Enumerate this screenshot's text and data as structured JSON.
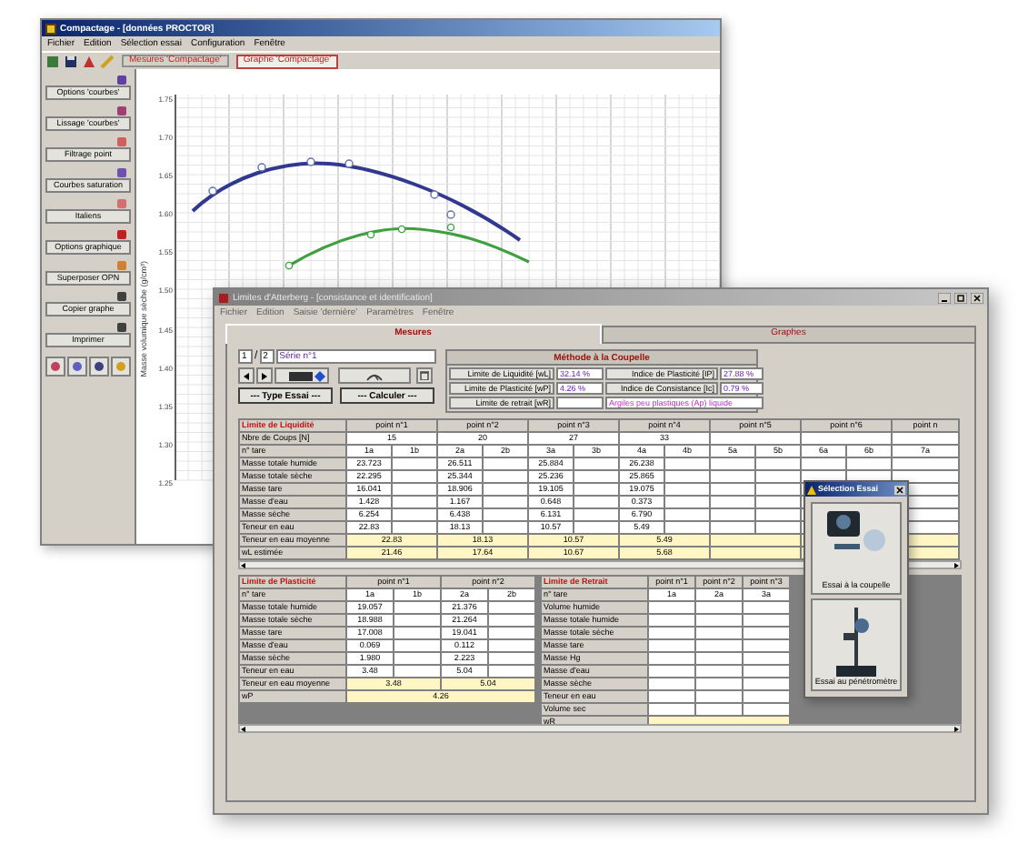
{
  "back_window": {
    "title": "Compactage - [données PROCTOR]",
    "menu": [
      "Fichier",
      "Edition",
      "Sélection essai",
      "Configuration",
      "Fenêtre"
    ],
    "tabs": [
      {
        "label": "Mesures 'Compactage'",
        "selected": false
      },
      {
        "label": "Graphe 'Compactage'",
        "selected": true
      }
    ],
    "tools": [
      "Options 'courbes'",
      "Lissage 'courbes'",
      "Filtrage point",
      "Courbes saturation",
      "Italiens",
      "Options graphique",
      "Superposer OPN",
      "Copier graphe",
      "Imprimer"
    ],
    "chart": {
      "y_axis_title": "Masse volumique sèche (g/cm³)",
      "y_ticks": [
        "1.75",
        "1.70",
        "1.65",
        "1.60",
        "1.55",
        "1.50",
        "1.45",
        "1.40",
        "1.35",
        "1.30",
        "1.25"
      ]
    }
  },
  "front_window": {
    "title": "Limites d'Atterberg - [consistance et identification]",
    "menu": [
      "Fichier",
      "Edition",
      "Saisie 'dernière'",
      "Paramètres",
      "Fenêtre"
    ],
    "tabs": [
      {
        "label": "Mesures",
        "selected": true
      },
      {
        "label": "Graphes",
        "selected": false
      }
    ],
    "series": {
      "index": "1",
      "separator": "/",
      "count": "2",
      "name": "Série n°1"
    },
    "buttons": [
      "--- Type Essai ---",
      "--- Calculer ---"
    ],
    "method": {
      "title": "Méthode à la Coupelle",
      "results": [
        {
          "label": "Limite de Liquidité [wL]",
          "value": "32.14 %"
        },
        {
          "label": "Limite de Plasticité [wP]",
          "value": "4.26 %"
        },
        {
          "label": "Limite de retrait [wR]"
        }
      ],
      "indices": [
        {
          "label": "Indice de Plasticité [IP]",
          "value": "27.88 %"
        },
        {
          "label": "Indice de Consistance [Ic]",
          "value": "0.79 %"
        }
      ],
      "classification": "Argiles peu plastiques (Ap) liquide"
    },
    "tables": [
      {
        "title": "Limite de Liquidité",
        "kind": "double",
        "cut_last": true,
        "columns": [
          "point n°1",
          "point n°2",
          "point n°3",
          "point n°4",
          "point n°5",
          "point n°6",
          "point n"
        ],
        "rows": [
          {
            "label": "Nbre de Coups [N]",
            "kind": "point",
            "highlight": false,
            "values": [
              "15",
              "20",
              "27",
              "33"
            ]
          },
          {
            "label": "n° tare",
            "kind": "sub",
            "highlight": false,
            "points": [
              {
                "a": "1a",
                "b": "1b"
              },
              {
                "a": "2a",
                "b": "2b"
              },
              {
                "a": "3a",
                "b": "3b"
              },
              {
                "a": "4a",
                "b": "4b"
              },
              {
                "a": "5a",
                "b": "5b"
              },
              {
                "a": "6a",
                "b": "6b"
              },
              {
                "a": "7a"
              }
            ]
          },
          {
            "label": "Masse totale humide",
            "kind": "sub",
            "highlight": false,
            "points": [
              {
                "a": "23.723"
              },
              {
                "a": "26.511"
              },
              {
                "a": "25.884"
              },
              {
                "a": "26.238"
              }
            ]
          },
          {
            "label": "Masse totale sèche",
            "kind": "sub",
            "highlight": false,
            "points": [
              {
                "a": "22.295"
              },
              {
                "a": "25.344"
              },
              {
                "a": "25.236"
              },
              {
                "a": "25.865"
              }
            ]
          },
          {
            "label": "Masse tare",
            "kind": "sub",
            "highlight": false,
            "points": [
              {
                "a": "16.041"
              },
              {
                "a": "18.906"
              },
              {
                "a": "19.105"
              },
              {
                "a": "19.075"
              }
            ]
          },
          {
            "label": "Masse d'eau",
            "kind": "sub",
            "highlight": false,
            "points": [
              {
                "a": "1.428"
              },
              {
                "a": "1.167"
              },
              {
                "a": "0.648"
              },
              {
                "a": "0.373"
              }
            ]
          },
          {
            "label": "Masse sèche",
            "kind": "sub",
            "highlight": false,
            "points": [
              {
                "a": "6.254"
              },
              {
                "a": "6.438"
              },
              {
                "a": "6.131"
              },
              {
                "a": "6.790"
              }
            ]
          },
          {
            "label": "Teneur en eau",
            "kind": "sub",
            "highlight": false,
            "points": [
              {
                "a": "22.83"
              },
              {
                "a": "18.13"
              },
              {
                "a": "10.57"
              },
              {
                "a": "5.49"
              }
            ]
          },
          {
            "label": "Teneur en eau moyenne",
            "kind": "point",
            "highlight": true,
            "values": [
              "22.83",
              "18.13",
              "10.57",
              "5.49"
            ]
          },
          {
            "label": "wL estimée",
            "kind": "point",
            "highlight": true,
            "values": [
              "21.46",
              "17.64",
              "10.67",
              "5.68"
            ]
          }
        ]
      },
      {
        "title": "Limite de Plasticité",
        "kind": "double",
        "cut_last": false,
        "columns": [
          "point n°1",
          "point n°2"
        ],
        "rows": [
          {
            "label": "n° tare",
            "kind": "sub",
            "highlight": false,
            "points": [
              {
                "a": "1a",
                "b": "1b"
              },
              {
                "a": "2a",
                "b": "2b"
              }
            ]
          },
          {
            "label": "Masse totale humide",
            "kind": "sub",
            "highlight": false,
            "points": [
              {
                "a": "19.057"
              },
              {
                "a": "21.376"
              }
            ]
          },
          {
            "label": "Masse totale sèche",
            "kind": "sub",
            "highlight": false,
            "points": [
              {
                "a": "18.988"
              },
              {
                "a": "21.264"
              }
            ]
          },
          {
            "label": "Masse tare",
            "kind": "sub",
            "highlight": false,
            "points": [
              {
                "a": "17.008"
              },
              {
                "a": "19.041"
              }
            ]
          },
          {
            "label": "Masse d'eau",
            "kind": "sub",
            "highlight": false,
            "points": [
              {
                "a": "0.069"
              },
              {
                "a": "0.112"
              }
            ]
          },
          {
            "label": "Masse sèche",
            "kind": "sub",
            "highlight": false,
            "points": [
              {
                "a": "1.980"
              },
              {
                "a": "2.223"
              }
            ]
          },
          {
            "label": "Teneur en eau",
            "kind": "sub",
            "highlight": false,
            "points": [
              {
                "a": "3.48"
              },
              {
                "a": "5.04"
              }
            ]
          },
          {
            "label": "Teneur en eau moyenne",
            "kind": "point",
            "highlight": true,
            "values": [
              "3.48",
              "5.04"
            ]
          },
          {
            "label": "wP",
            "kind": "all",
            "highlight": true,
            "values": [
              "4.26"
            ]
          }
        ]
      },
      {
        "title": "Limite de Retrait",
        "kind": "single",
        "cut_last": false,
        "columns": [
          "point n°1",
          "point n°2",
          "point n°3"
        ],
        "rows": [
          {
            "label": "n° tare",
            "kind": "sub",
            "highlight": false,
            "points": [
              {
                "a": "1a"
              },
              {
                "a": "2a"
              },
              {
                "a": "3a"
              }
            ]
          },
          {
            "label": "Volume humide",
            "kind": "sub",
            "highlight": false
          },
          {
            "label": "Masse totale humide",
            "kind": "sub",
            "highlight": false
          },
          {
            "label": "Masse totale sèche",
            "kind": "sub",
            "highlight": false
          },
          {
            "label": "Masse tare",
            "kind": "sub",
            "highlight": false
          },
          {
            "label": "Masse Hg",
            "kind": "sub",
            "highlight": false
          },
          {
            "label": "Masse d'eau",
            "kind": "sub",
            "highlight": false
          },
          {
            "label": "Masse sèche",
            "kind": "sub",
            "highlight": false
          },
          {
            "label": "Teneur en eau",
            "kind": "sub",
            "highlight": false
          },
          {
            "label": "Volume sec",
            "kind": "sub",
            "highlight": false
          },
          {
            "label": "wR",
            "kind": "all",
            "highlight": true
          }
        ]
      }
    ]
  },
  "dialog": {
    "title": "Sélection Essai",
    "options": [
      "Essai à la coupelle",
      "Essai au pénétromètre"
    ]
  }
}
